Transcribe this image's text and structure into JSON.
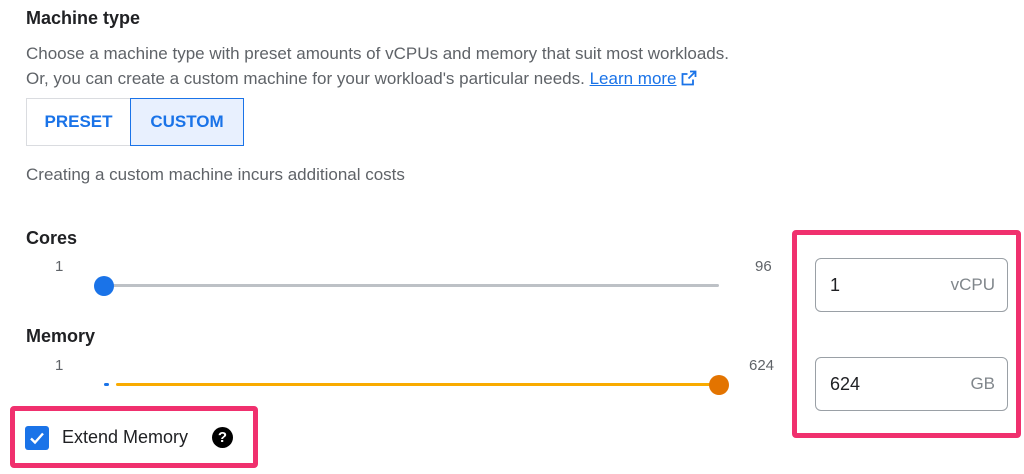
{
  "section": {
    "title": "Machine type",
    "desc_line1": "Choose a machine type with preset amounts of vCPUs and memory that suit most workloads.",
    "desc_line2": "Or, you can create a custom machine for your workload's particular needs.",
    "learn_more": "Learn more"
  },
  "tabs": {
    "preset": "PRESET",
    "custom": "CUSTOM",
    "selected": "CUSTOM"
  },
  "cost_note": "Creating a custom machine incurs additional costs",
  "cores": {
    "label": "Cores",
    "min": "1",
    "max": "96",
    "value": "1",
    "unit": "vCPU",
    "fraction": 0.0
  },
  "memory": {
    "label": "Memory",
    "min": "1",
    "max": "624",
    "value": "624",
    "unit": "GB",
    "fraction": 1.0
  },
  "extend_memory": {
    "label": "Extend Memory",
    "checked": true,
    "help_icon": "help-icon"
  },
  "colors": {
    "accent": "#1a73e8",
    "memory_track": "#f9ab00",
    "memory_thumb": "#e37400",
    "inactive_track": "#bdc1c6",
    "highlight": "#f0306e"
  }
}
